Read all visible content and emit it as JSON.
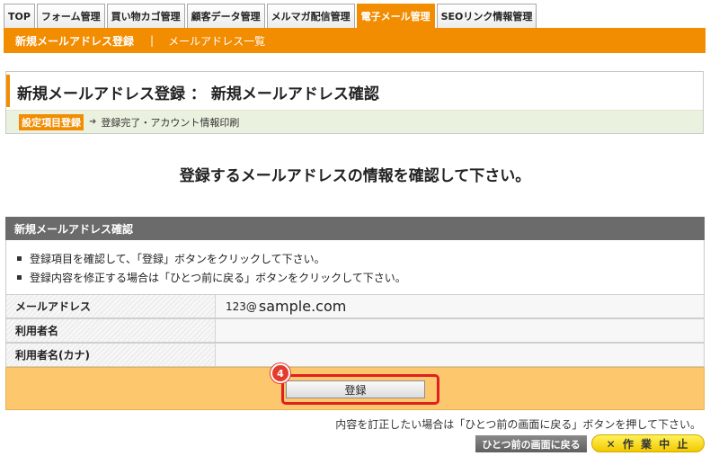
{
  "tabs": [
    {
      "label": "TOP"
    },
    {
      "label": "フォーム管理"
    },
    {
      "label": "買い物カゴ管理"
    },
    {
      "label": "顧客データ管理"
    },
    {
      "label": "メルマガ配信管理"
    },
    {
      "label": "電子メール管理",
      "active": true
    },
    {
      "label": "SEOリンク情報管理"
    }
  ],
  "subnav": {
    "current": "新規メールアドレス登録",
    "separator": "|",
    "link": "メールアドレス一覧"
  },
  "page": {
    "title": "新規メールアドレス登録 ： 新規メールアドレス確認",
    "steps": {
      "current": "設定項目登録",
      "arrow": "➜",
      "next": "登録完了・アカウント情報印刷"
    },
    "confirm_message": "登録するメールアドレスの情報を確認して下さい。"
  },
  "section": {
    "header": "新規メールアドレス確認",
    "notes": [
      "登録項目を確認して、「登録」ボタンをクリックして下さい。",
      "登録内容を修正する場合は「ひとつ前に戻る」ボタンをクリックして下さい。"
    ],
    "fields": [
      {
        "label": "メールアドレス",
        "value_prefix": "123@",
        "value_domain": "sample.com"
      },
      {
        "label": "利用者名",
        "value": ""
      },
      {
        "label": "利用者名(カナ)",
        "value": ""
      }
    ],
    "submit_label": "登録",
    "step_badge": "4"
  },
  "footer": {
    "note": "内容を訂正したい場合は「ひとつ前の画面に戻る」ボタンを押して下さい。",
    "back_label": "ひとつ前の画面に戻る",
    "cancel_label": "✕ 作 業 中 止"
  },
  "colors": {
    "accent": "#f28c00",
    "submit_area": "#fdc76d",
    "highlight": "#e02020"
  }
}
